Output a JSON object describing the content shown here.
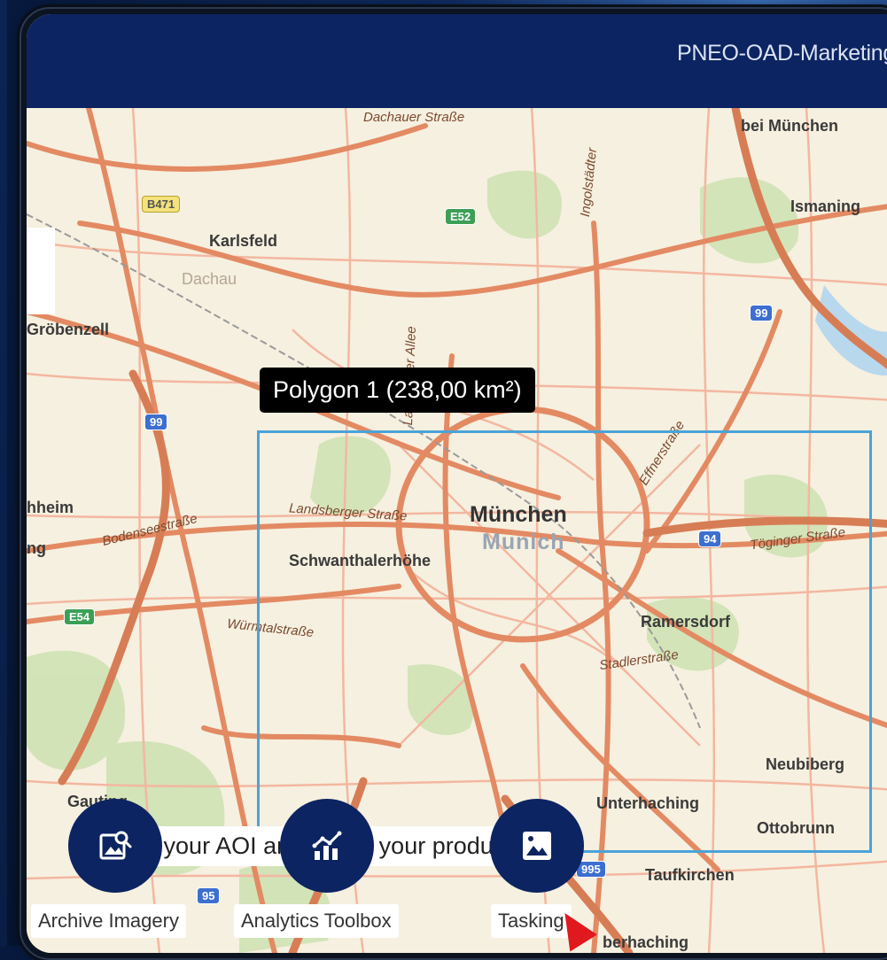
{
  "header": {
    "title": "PNEO-OAD-Marketing"
  },
  "map": {
    "places": {
      "karlsfeld": "Karlsfeld",
      "dachau": "Dachau",
      "grobenzell": "Gröbenzell",
      "munchen": "München",
      "munich": "Munich",
      "schwanthalerhohe": "Schwanthalerhöhe",
      "ramersdorf": "Ramersdorf",
      "ismaning": "Ismaning",
      "bei_munchen": "bei München",
      "neubiberg": "Neubiberg",
      "unterhaching": "Unterhaching",
      "ottobrunn": "Ottobrunn",
      "taufkirchen": "Taufkirchen",
      "gauting": "Gauting",
      "oberhaching": "berhaching",
      "heim": "hheim",
      "ng": "ng"
    },
    "streets": {
      "dachauer": "Dachauer Straße",
      "landsberger": "Landsberger Straße",
      "bodensee": "Bodenseestraße",
      "wurmtal": "Würmtalstraße",
      "landshuter": "Landshuter Allee",
      "effner": "Effnerstraße",
      "toginger": "Töginger Straße",
      "stadler": "Stadlerstraße",
      "ingolstadter": "Ingolstädter"
    },
    "shields": {
      "b471": "B471",
      "e52": "E52",
      "a99_top": "99",
      "a99_left": "99",
      "a94": "94",
      "e54": "E54",
      "a95": "95",
      "a995": "995"
    },
    "polygon_label": "Polygon 1 (238,00 km²)",
    "hint": "Adjust your AOI and select your product"
  },
  "actions": [
    {
      "label": "Archive Imagery",
      "icon": "image-search-icon"
    },
    {
      "label": "Analytics Toolbox",
      "icon": "analytics-chart-icon"
    },
    {
      "label": "Tasking",
      "icon": "image-icon"
    }
  ],
  "colors": {
    "header_bg": "#0c2461",
    "aoi_border": "#4aa3d8",
    "fab_bg": "#0c2461"
  }
}
